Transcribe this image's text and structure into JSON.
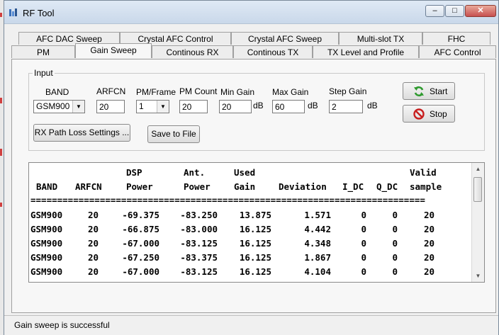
{
  "window": {
    "title": "RF Tool",
    "minimize": "–",
    "maximize": "□",
    "close": "✕"
  },
  "tabs_row1": [
    "AFC DAC Sweep",
    "Crystal AFC Control",
    "Crystal AFC Sweep",
    "Multi-slot TX",
    "FHC"
  ],
  "tabs_row2": [
    "PM",
    "Gain Sweep",
    "Continous RX",
    "Continous TX",
    "TX Level and Profile",
    "AFC Control"
  ],
  "active_tab": "Gain Sweep",
  "input": {
    "group_label": "Input",
    "band_label": "BAND",
    "band_value": "GSM900",
    "arfcn_label": "ARFCN",
    "arfcn_value": "20",
    "pm_frame_label": "PM/Frame",
    "pm_frame_value": "1",
    "pm_count_label": "PM Count",
    "pm_count_value": "20",
    "min_gain_label": "Min Gain",
    "min_gain_value": "20",
    "max_gain_label": "Max Gain",
    "max_gain_value": "60",
    "step_gain_label": "Step Gain",
    "step_gain_value": "2",
    "unit": "dB",
    "rx_path_loss_button": "RX Path Loss Settings ...",
    "save_button": "Save to File",
    "start_button": "Start",
    "stop_button": "Stop"
  },
  "results": {
    "header_top": [
      "",
      "",
      "DSP",
      "Ant.",
      "Used",
      "",
      "",
      "",
      "Valid"
    ],
    "header_bottom": [
      "BAND",
      "ARFCN",
      "Power",
      "Power",
      "Gain",
      "Deviation",
      "I_DC",
      "Q_DC",
      "sample"
    ],
    "separator": "==========================================================================",
    "rows": [
      [
        "GSM900",
        "20",
        "-69.375",
        "-83.250",
        "13.875",
        "1.571",
        "0",
        "0",
        "20"
      ],
      [
        "GSM900",
        "20",
        "-66.875",
        "-83.000",
        "16.125",
        "4.442",
        "0",
        "0",
        "20"
      ],
      [
        "GSM900",
        "20",
        "-67.000",
        "-83.125",
        "16.125",
        "4.348",
        "0",
        "0",
        "20"
      ],
      [
        "GSM900",
        "20",
        "-67.250",
        "-83.375",
        "16.125",
        "1.867",
        "0",
        "0",
        "20"
      ],
      [
        "GSM900",
        "20",
        "-67.000",
        "-83.125",
        "16.125",
        "4.104",
        "0",
        "0",
        "20"
      ]
    ]
  },
  "status": {
    "text": "Gain sweep is successful"
  },
  "colors": {
    "start_icon": "#2e9a2e",
    "stop_icon": "#c81e1e",
    "titlebar": "#c9d8ea"
  }
}
